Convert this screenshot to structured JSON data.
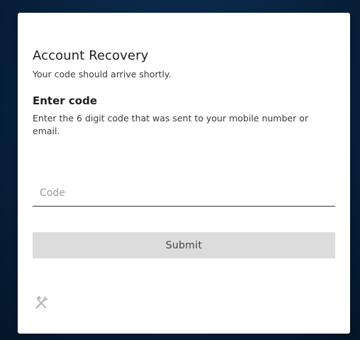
{
  "recovery": {
    "title": "Account Recovery",
    "subtitle": "Your code should arrive shortly.",
    "section_title": "Enter code",
    "instructions": "Enter the 6 digit code that was sent to your mobile number or email.",
    "code_field": {
      "placeholder": "Code",
      "value": ""
    },
    "submit_label": "Submit",
    "footer_icon": "tools-icon"
  },
  "colors": {
    "background": "#0a2745",
    "card": "#ffffff",
    "button": "#dcdcdc",
    "icon": "#bdbdbd"
  }
}
